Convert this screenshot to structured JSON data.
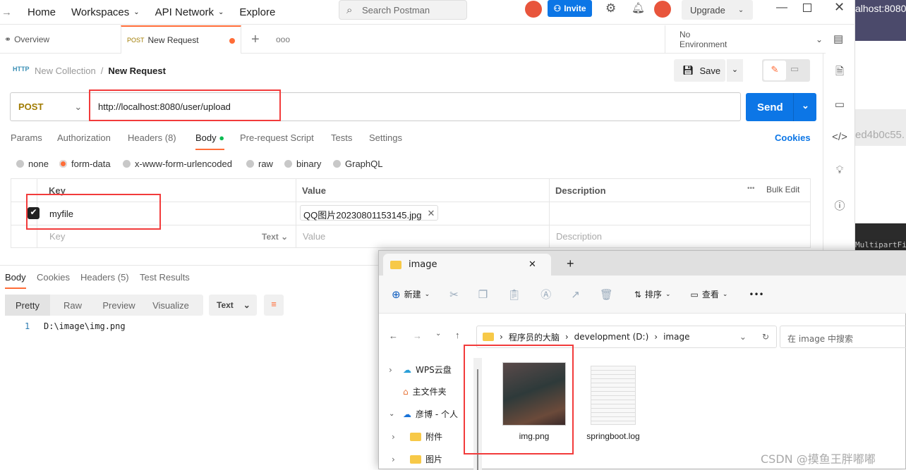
{
  "background": {
    "browser_url": "alhost:8080/",
    "hash": "ed4b0c55.",
    "terminal": "MultipartFi"
  },
  "postman": {
    "nav": {
      "back": "→",
      "home": "Home",
      "workspaces": "Workspaces",
      "api_network": "API Network",
      "explore": "Explore"
    },
    "search_placeholder": "Search Postman",
    "invite": "Invite",
    "upgrade": "Upgrade",
    "tabs": {
      "overview": "Overview",
      "request_method": "POST",
      "request_name": "New Request",
      "environment": "No Environment"
    },
    "breadcrumb": {
      "collection": "New Collection",
      "separator": "/",
      "request": "New Request"
    },
    "save": "Save",
    "request": {
      "method": "POST",
      "url": "http://localhost:8080/user/upload",
      "send": "Send",
      "cookies": "Cookies"
    },
    "request_tabs": [
      "Params",
      "Authorization",
      "Headers (8)",
      "Body",
      "Pre-request Script",
      "Tests",
      "Settings"
    ],
    "active_request_tab": "Body",
    "body_types": [
      "none",
      "form-data",
      "x-www-form-urlencoded",
      "raw",
      "binary",
      "GraphQL"
    ],
    "selected_body_type": "form-data",
    "table": {
      "headers": {
        "key": "Key",
        "value": "Value",
        "description": "Description",
        "bulk_edit": "Bulk Edit",
        "more": "•••"
      },
      "rows": [
        {
          "checked": true,
          "key": "myfile",
          "value": "QQ图片20230801153145.jpg",
          "description": ""
        }
      ],
      "placeholder": {
        "key": "Key",
        "type": "Text",
        "value": "Value",
        "description": "Description"
      }
    },
    "response_tabs": [
      "Body",
      "Cookies",
      "Headers (5)",
      "Test Results"
    ],
    "view_modes": [
      "Pretty",
      "Raw",
      "Preview",
      "Visualize"
    ],
    "selected_view": "Pretty",
    "format": "Text",
    "response_lines": [
      {
        "line": "1",
        "text": "D:\\image\\img.png"
      }
    ],
    "colors": {
      "accent": "#ff6c37",
      "send": "#0c76e6",
      "highlight": "#f23b3b"
    }
  },
  "explorer": {
    "tab_title": "image",
    "toolbar": {
      "new": "新建",
      "sort": "排序",
      "view": "查看",
      "more": "•••"
    },
    "breadcrumb": [
      "程序员的大脑",
      "development (D:)",
      "image"
    ],
    "search_placeholder": "在 image 中搜索",
    "tree": [
      {
        "label": "WPS云盘",
        "expanded": false
      },
      {
        "label": "主文件夹"
      },
      {
        "label": "彦博 - 个人",
        "expanded": true
      },
      {
        "label": "附件",
        "expanded": false
      },
      {
        "label": "图片",
        "expanded": false
      }
    ],
    "files": [
      {
        "name": "img.png",
        "type": "image"
      },
      {
        "name": "springboot.log",
        "type": "log"
      }
    ]
  },
  "watermark": "CSDN @摸鱼王胖嘟嘟"
}
